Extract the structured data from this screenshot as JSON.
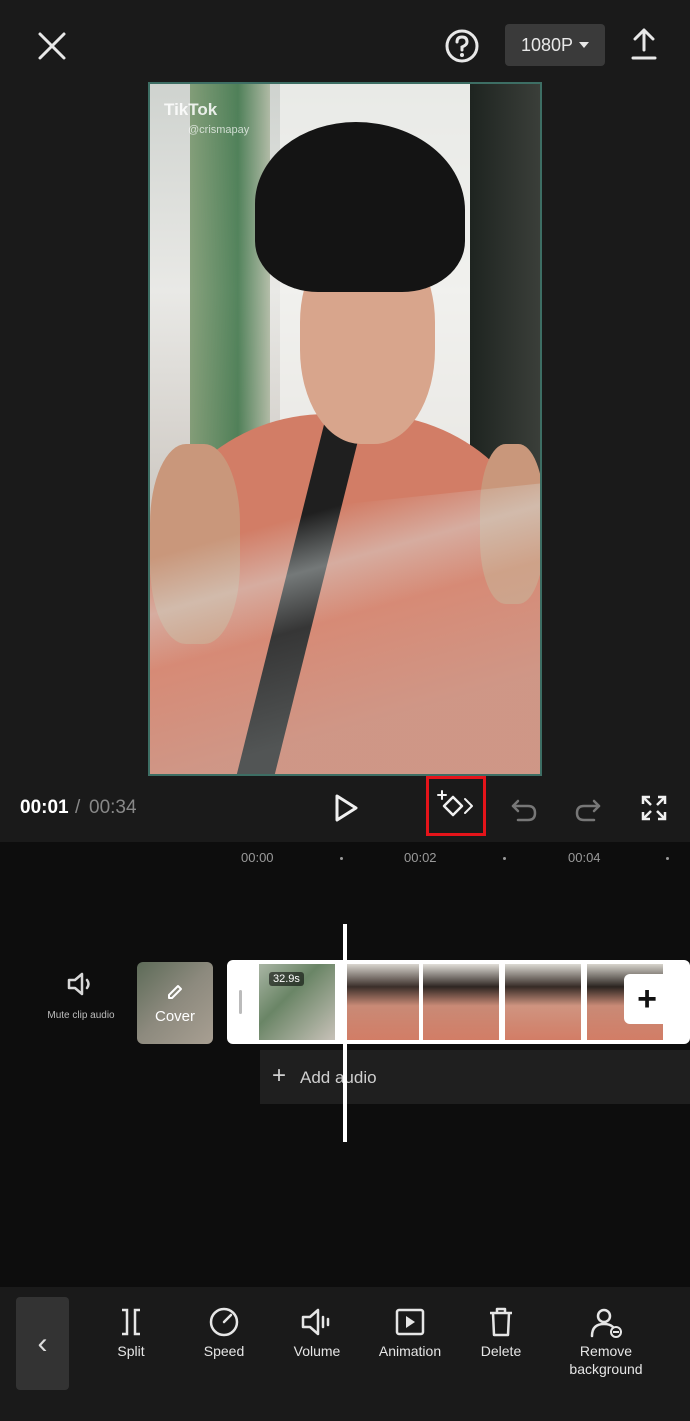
{
  "header": {
    "close_icon": "close-icon",
    "help_icon": "help-icon",
    "resolution": "1080P",
    "export_icon": "upload-icon"
  },
  "preview": {
    "watermark_logo": "TikTok",
    "watermark_handle": "@crismapay"
  },
  "playback": {
    "current_time": "00:01",
    "separator": "/",
    "total_time": "00:34",
    "highlight_color": "#e5141a"
  },
  "timeline": {
    "ruler": [
      "00:00",
      "00:02",
      "00:04"
    ],
    "mute_label": "Mute clip audio",
    "cover_label": "Cover",
    "clip_duration_badge": "32.9s",
    "add_audio_label": "Add audio"
  },
  "toolbar": {
    "back_icon": "chevron-left-icon",
    "items": [
      {
        "label": "Split",
        "icon": "split-icon"
      },
      {
        "label": "Speed",
        "icon": "speed-icon"
      },
      {
        "label": "Volume",
        "icon": "volume-icon"
      },
      {
        "label": "Animation",
        "icon": "animation-icon"
      },
      {
        "label": "Delete",
        "icon": "trash-icon"
      },
      {
        "label": "Remove background",
        "icon": "remove-background-icon"
      }
    ]
  }
}
